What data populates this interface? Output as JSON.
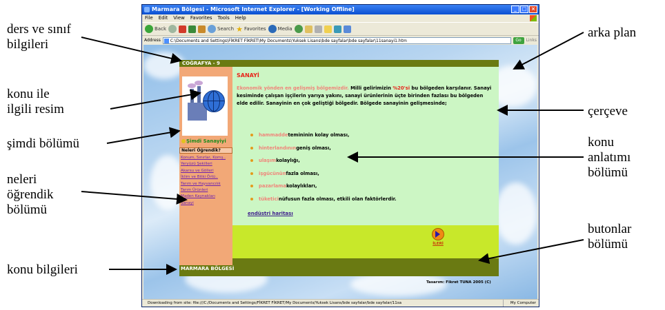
{
  "annotations": {
    "ders_sinif": [
      "ders ve sınıf",
      "bilgileri"
    ],
    "konu_resim": [
      "konu ile",
      "ilgili resim"
    ],
    "simdi": [
      "şimdi bölümü"
    ],
    "neleri": [
      "neleri",
      "öğrendik",
      "bölümü"
    ],
    "konu_bilgileri": [
      "konu bilgileri"
    ],
    "arka_plan": [
      "arka plan"
    ],
    "cerceve": [
      "çerçeve"
    ],
    "konu_anlatimi": [
      "konu",
      "anlatımı",
      "bölümü"
    ],
    "butonlar": [
      "butonlar",
      "bölümü"
    ]
  },
  "browser": {
    "title": "Marmara Bölgesi - Microsoft Internet Explorer - [Working Offline]",
    "menu": [
      "File",
      "Edit",
      "View",
      "Favorites",
      "Tools",
      "Help"
    ],
    "toolbar": {
      "back": "Back",
      "search": "Search",
      "favorites": "Favorites",
      "media": "Media"
    },
    "address_label": "Address",
    "address": "C:\\Documents and Settings\\FİKRET FİKRET\\My Documents\\Yuksek Lisans\\bde sayfalar\\bde sayfalar\\11sanayi1.htm",
    "go": "Go",
    "links": "Links",
    "status": "Downloading from site: file:///C:/Documents and Settings/FİKRET FİKRET/My Documents/Yuksek Lisans/bde sayfalar/bde sayfalar/11sa",
    "status_right": "My Computer"
  },
  "page": {
    "header": "COĞRAFYA - 9",
    "now_text": "Şimdi Sanayiyi",
    "learned_head": "Neleri Öğrendik?",
    "topics": [
      "Konum, Sınırlar, Komş..",
      "Yeryüzü Şekilleri",
      "Akarsu ve Gölleri",
      "İklim ve Bitki Örtü..",
      "Tarım ve Hayvancılık",
      "Tarım Ürünleri",
      "Maden Kaynakları",
      "Sanayi"
    ],
    "title": "SANAYİ",
    "para_o": "Ekonomik yönden en gelişmiş bölgemizdir.",
    "para_1": " Milli gelirimizin ",
    "para_r": "%20'si",
    "para_2": " bu bölgeden karşılanır. Sanayi kesiminde çalışan işçilerin yarıya yakını, sanayi ürünlerinin üçte birinden fazlası bu bölgeden elde edilir. Sanayinin en çok geliştiği bölgedir. Bölgede sanayinin gelişmesinde;",
    "bullets": [
      {
        "k": "hammadde",
        "t": " temininin kolay olması,"
      },
      {
        "k": "hinterlandının",
        "t": " geniş olması,"
      },
      {
        "k": "ulaşım",
        "t": " kolaylığı,"
      },
      {
        "k": "işgücünün",
        "t": " fazla olması,"
      },
      {
        "k": "pazarlama",
        "t": " kolaylıkları,"
      },
      {
        "k": "tüketici",
        "t": " nüfusun fazla olması, etkili olan faktörlerdir."
      }
    ],
    "link": "endüstri haritası",
    "next": "İLERİ",
    "footer_left": "MARMARA BÖLGESİ",
    "credit": "Tasarım: Fikret TUNA 2005 (C)"
  }
}
